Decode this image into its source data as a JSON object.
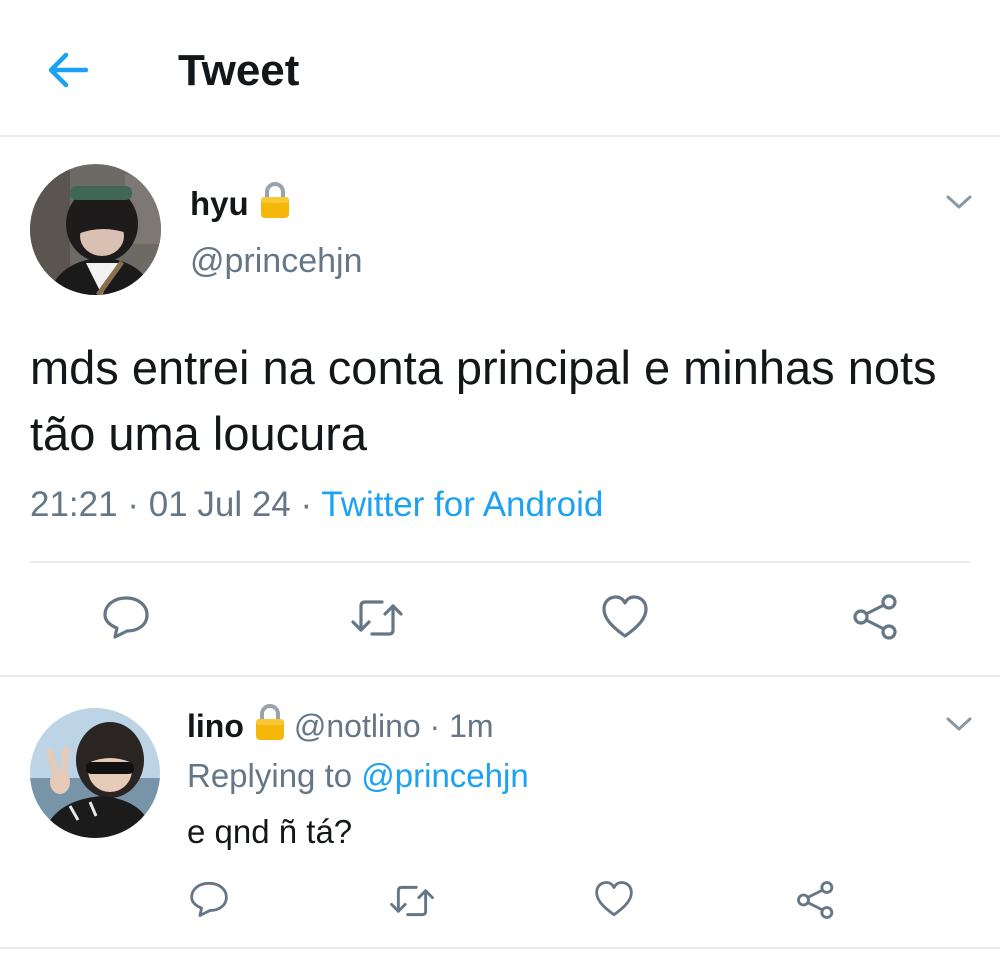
{
  "header": {
    "title": "Tweet",
    "back_icon": "arrow-left-icon",
    "accent": "#1da1f2"
  },
  "tweet": {
    "name": "hyu",
    "handle": "@princehjn",
    "protected_icon": "lock-icon",
    "text": "mds entrei na conta principal e minhas nots tão uma loucura",
    "time": "21:21",
    "date": "01 Jul 24",
    "source": "Twitter for Android",
    "separator": "·",
    "actions": [
      "reply-icon",
      "retweet-icon",
      "like-icon",
      "share-icon"
    ]
  },
  "reply": {
    "name": "lino",
    "handle": "@notlino",
    "separator": "·",
    "time": "1m",
    "replying_prefix": "Replying to",
    "replying_to": "@princehjn",
    "text": "e qnd ñ tá?",
    "actions": [
      "reply-icon",
      "retweet-icon",
      "like-icon",
      "share-icon"
    ]
  },
  "colors": {
    "text_primary": "#14171a",
    "text_secondary": "#657786",
    "link": "#1da1f2",
    "divider": "#e6ecf0",
    "lock_body": "#f5b70a"
  }
}
